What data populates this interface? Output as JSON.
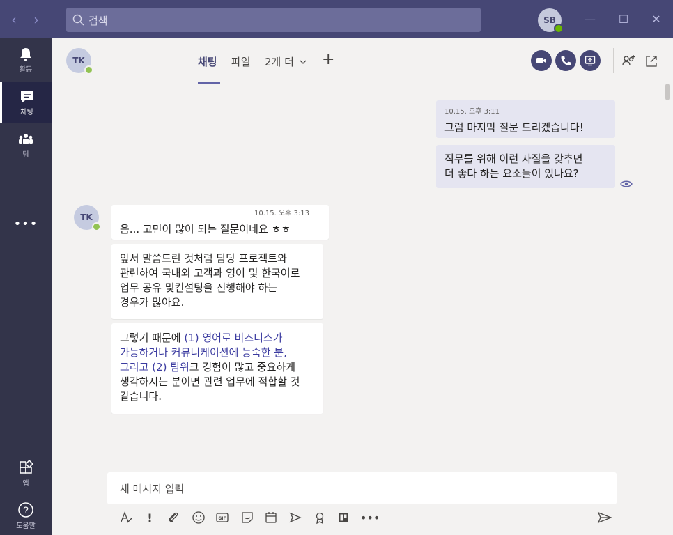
{
  "titlebar": {
    "search_placeholder": "검색",
    "me_initials": "SB"
  },
  "rail": {
    "items": [
      {
        "label": "활동",
        "icon": "bell-icon"
      },
      {
        "label": "채팅",
        "icon": "chat-icon"
      },
      {
        "label": "팀",
        "icon": "teams-icon"
      },
      {
        "label": "앱",
        "icon": "apps-icon"
      },
      {
        "label": "도움말",
        "icon": "help-icon"
      }
    ],
    "more": "•••"
  },
  "header": {
    "contact_initials": "TK",
    "tabs": [
      {
        "label": "채팅"
      },
      {
        "label": "파일"
      },
      {
        "label": "2개 더"
      }
    ],
    "add_tab": "+"
  },
  "messages": {
    "sent": [
      {
        "time": "10.15. 오후 3:11",
        "text": "그럼 마지막 질문 드리겠습니다!"
      },
      {
        "line1": "직무를 위해 이런 자질을 갖추면",
        "line2": "더 좋다 하는 요소들이 있나요?"
      }
    ],
    "recv": [
      {
        "time": "10.15. 오후 3:13",
        "text": "음... 고민이 많이 되는 질문이네요 ㅎㅎ"
      },
      {
        "lines": [
          "앞서 말씀드린 것처럼 담당 프로젝트와",
          "관련하여 국내외 고객과 영어 및 한국어로",
          "업무 공유 및컨설팅을 진행해야 하는",
          "경우가 많아요."
        ]
      },
      {
        "l1a": "그렇기 때문에 ",
        "l1b": "(1) 영어로 비즈니스가",
        "l2": "가능하거나 커뮤니케이션에 능숙한 분,",
        "l3a": "그리고 (2) 팀워",
        "l3b": "크 경험이 많고 중요하게",
        "l4": "생각하시는 분이면 관련 업무에 적합할 것",
        "l5": "같습니다."
      }
    ],
    "recv_initials": "TK"
  },
  "compose": {
    "placeholder": "새 메시지 입력"
  },
  "colors": {
    "brand": "#464775",
    "rail": "#33344a",
    "sent_bubble": "#e5e5f1",
    "status_online": "#92c353"
  }
}
